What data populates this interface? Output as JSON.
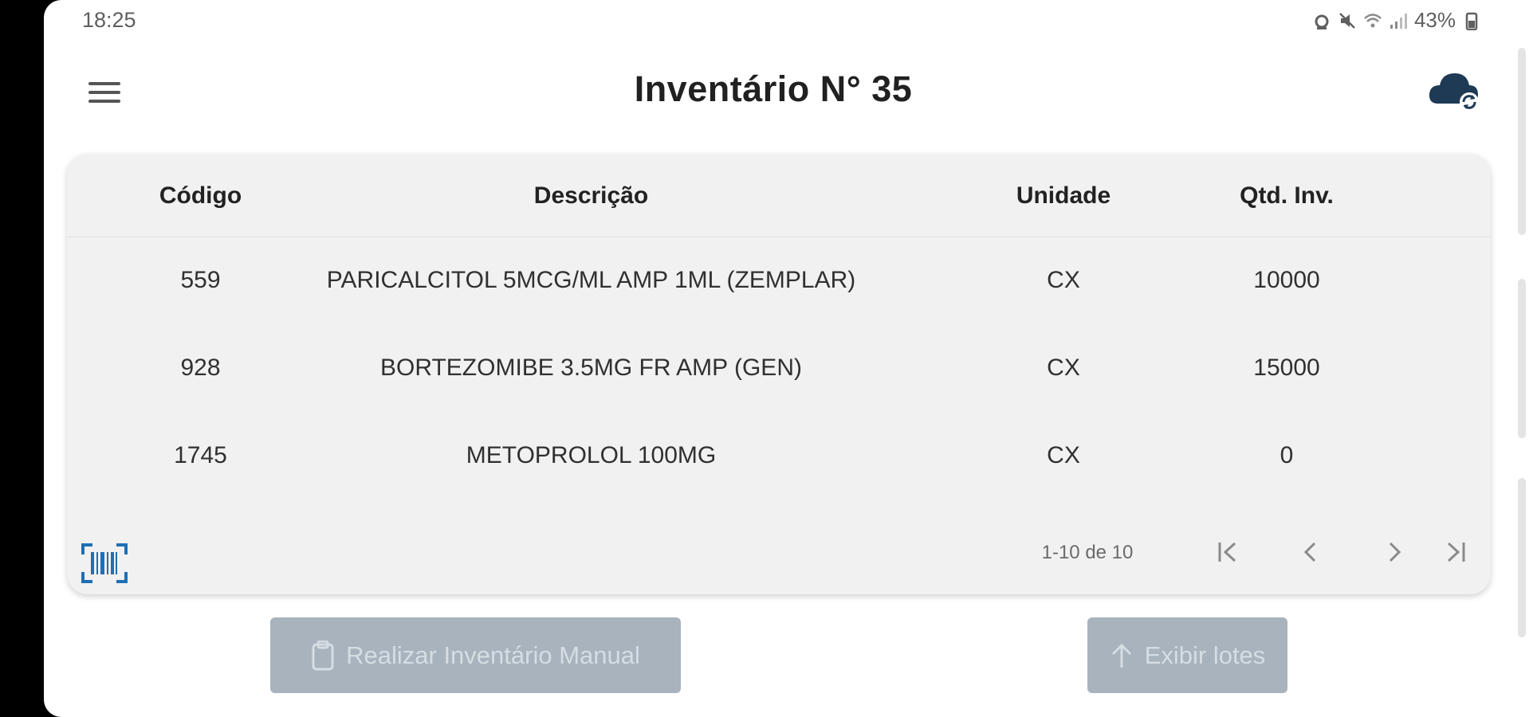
{
  "status": {
    "time": "18:25",
    "battery": "43%"
  },
  "header": {
    "title": "Inventário N° 35",
    "menu_icon": "hamburger-menu-icon",
    "sync_icon": "cloud-sync-icon"
  },
  "table": {
    "columns": [
      "Código",
      "Descrição",
      "Unidade",
      "Qtd. Inv."
    ],
    "rows": [
      {
        "codigo": "559",
        "descricao": "PARICALCITOL 5MCG/ML AMP 1ML (ZEMPLAR)",
        "unidade": "CX",
        "qtd": "10000"
      },
      {
        "codigo": "928",
        "descricao": "BORTEZOMIBE 3.5MG FR AMP (GEN)",
        "unidade": "CX",
        "qtd": "15000"
      },
      {
        "codigo": "1745",
        "descricao": "METOPROLOL 100MG",
        "unidade": "CX",
        "qtd": "0"
      }
    ]
  },
  "pagination": {
    "info": "1-10 de 10",
    "icons": [
      "first-page-icon",
      "previous-page-icon",
      "next-page-icon",
      "last-page-icon"
    ]
  },
  "actions": {
    "manual_label": "Realizar Inventário Manual",
    "lotes_label": "Exibir lotes"
  },
  "colors": {
    "card_bg": "#f1f1f1",
    "button_disabled": "#a8b3bd",
    "barcode_accent": "#1f6fb5",
    "cloud_icon": "#1e3a55"
  }
}
